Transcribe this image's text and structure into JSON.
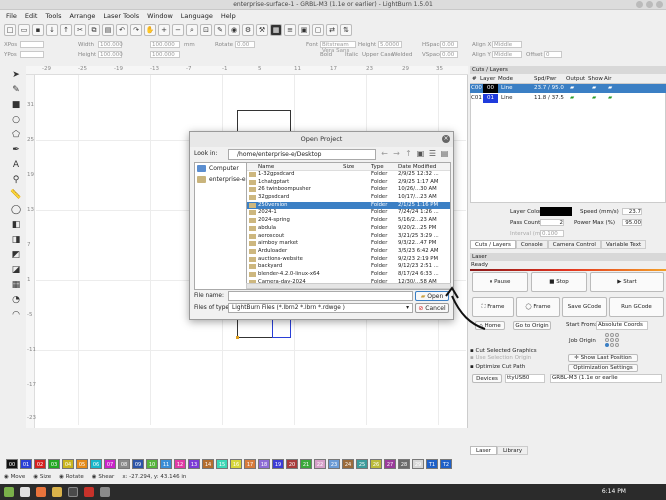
{
  "window": {
    "title": "enterprise-surface-1 - GRBL-M3 (1.1e or earlier) - LightBurn 1.5.01"
  },
  "menu": [
    "File",
    "Edit",
    "Tools",
    "Arrange",
    "Laser Tools",
    "Window",
    "Language",
    "Help"
  ],
  "ruler": {
    "x_ticks": [
      "-29",
      "-25",
      "-19",
      "-13",
      "-7",
      "-1",
      "5",
      "11",
      "17",
      "23",
      "29",
      "35",
      "41"
    ],
    "y_ticks": [
      "31",
      "25",
      "19",
      "13",
      "7",
      "1",
      "-5",
      "-11",
      "-17",
      "-23",
      "-29"
    ]
  },
  "position": {
    "xpos_label": "XPos",
    "ypos_label": "YPos",
    "width_label": "Width",
    "height_label": "Height",
    "xpos": "",
    "ypos": "",
    "width": "100.000",
    "height": "100.000",
    "units": "mm",
    "rotate_label": "Rotate",
    "rotate_value": "0.00"
  },
  "font_row": {
    "font_label": "Font",
    "font_value": "Bitstream Vera Sans",
    "height_label": "Height",
    "height_value": "5.0000",
    "bold": "Bold",
    "italic": "Italic",
    "upper": "Upper Case",
    "welded": "Welded",
    "hspace_label": "HSpace",
    "hspace": "0.00",
    "vspace_label": "VSpace",
    "vspace": "0.00",
    "alignx_label": "Align X",
    "alignx": "Middle",
    "aligny_label": "Align Y",
    "aligny": "Middle",
    "offset_label": "Offset",
    "offset": "0"
  },
  "cuts_layers": {
    "title": "Cuts / Layers",
    "headers": [
      "#",
      "Layer",
      "Mode",
      "Spd/Pwr",
      "Output",
      "Show",
      "Air"
    ],
    "rows": [
      {
        "num": "C00",
        "layer": "00",
        "mode": "Line",
        "spd_pwr": "23.7 / 95.0",
        "color": "#000000",
        "selected": true
      },
      {
        "num": "C01",
        "layer": "01",
        "mode": "Line",
        "spd_pwr": "11.8 / 37.5",
        "color": "#1f3bdc",
        "selected": false
      }
    ],
    "layer_color_label": "Layer Color",
    "speed_label": "Speed (mm/s)",
    "speed_value": "23.7",
    "pass_count_label": "Pass Count",
    "pass_count_value": "2",
    "power_max_label": "Power Max (%)",
    "power_max_value": "95.00",
    "interval_label": "Interval (mm)",
    "interval_value": "0.100",
    "tabs": [
      "Cuts / Layers",
      "Console",
      "Camera Control",
      "Variable Text"
    ]
  },
  "laser": {
    "title": "Laser",
    "status": "Ready",
    "pause": "Pause",
    "stop": "Stop",
    "start": "Start",
    "frame1": "Frame",
    "frame2": "Frame",
    "save_gcode": "Save GCode",
    "run_gcode": "Run GCode",
    "home": "Home",
    "go_to_origin": "Go to Origin",
    "start_from_label": "Start From:",
    "start_from_value": "Absolute Coords",
    "job_origin_label": "Job Origin",
    "cut_selected": "Cut Selected Graphics",
    "use_selection_origin": "Use Selection Origin",
    "show_last_position": "Show Last Position",
    "optimize_cut_path": "Optimize Cut Path",
    "optimization_settings": "Optimization Settings",
    "devices": "Devices",
    "port": "ttyUSB0",
    "device": "GRBL-M3 (1.1e or earlie",
    "bottom_tabs": [
      "Laser",
      "Library"
    ]
  },
  "dialog": {
    "title": "Open Project",
    "look_in_label": "Look in:",
    "path": "/home/enterprise-e/Desktop",
    "places": [
      {
        "label": "Computer",
        "icon": "computer-icon"
      },
      {
        "label": "enterprise-e",
        "icon": "folder-icon"
      }
    ],
    "columns": [
      "Name",
      "Size",
      "Type",
      "Date Modified"
    ],
    "files": [
      {
        "name": "1-32gpsdcard",
        "size": "",
        "type": "Folder",
        "date": "2/9/25 12:32 ..."
      },
      {
        "name": "1chatgptart",
        "size": "",
        "type": "Folder",
        "date": "2/9/25 1:17 AM"
      },
      {
        "name": "26 twinboompusher",
        "size": "",
        "type": "Folder",
        "date": "10/26/...30 AM"
      },
      {
        "name": "32gpsdcard",
        "size": "",
        "type": "Folder",
        "date": "10/17/...23 AM"
      },
      {
        "name": "250version",
        "size": "",
        "type": "Folder",
        "date": "2/1/25 1:16 PM",
        "selected": true
      },
      {
        "name": "2024-1",
        "size": "",
        "type": "Folder",
        "date": "7/24/24 1:26 ..."
      },
      {
        "name": "2024-spring",
        "size": "",
        "type": "Folder",
        "date": "5/16/2...23 AM"
      },
      {
        "name": "abdula",
        "size": "",
        "type": "Folder",
        "date": "9/20/2...25 PM"
      },
      {
        "name": "aeroscout",
        "size": "",
        "type": "Folder",
        "date": "3/21/25 3:29 ..."
      },
      {
        "name": "aimboy market",
        "size": "",
        "type": "Folder",
        "date": "9/3/22...47 PM"
      },
      {
        "name": "Arduloader",
        "size": "",
        "type": "Folder",
        "date": "3/5/23 6:42 AM"
      },
      {
        "name": "auctions-website",
        "size": "",
        "type": "Folder",
        "date": "9/2/23 2:19 PM"
      },
      {
        "name": "backyard",
        "size": "",
        "type": "Folder",
        "date": "9/12/23 2:51 ..."
      },
      {
        "name": "blender-4.2.0-linux-x64",
        "size": "",
        "type": "Folder",
        "date": "8/17/24 6:33 ..."
      },
      {
        "name": "Camera-day-2024",
        "size": "",
        "type": "Folder",
        "date": "12/30/...58 AM"
      }
    ],
    "file_name_label": "File name:",
    "file_name_value": "",
    "files_of_type_label": "Files of type:",
    "files_of_type_value": "LightBurn Files (*.lbrn2 *.lbrn *.rdwge )",
    "open": "Open",
    "cancel": "Cancel"
  },
  "palette": [
    {
      "label": "00",
      "color": "#111111"
    },
    {
      "label": "01",
      "color": "#2a3fd6"
    },
    {
      "label": "02",
      "color": "#d42020"
    },
    {
      "label": "03",
      "color": "#22a822"
    },
    {
      "label": "04",
      "color": "#c9b51f"
    },
    {
      "label": "05",
      "color": "#e58a18"
    },
    {
      "label": "06",
      "color": "#18b6c9"
    },
    {
      "label": "07",
      "color": "#c924c9"
    },
    {
      "label": "08",
      "color": "#8a8a8a"
    },
    {
      "label": "09",
      "color": "#2c54a8"
    },
    {
      "label": "10",
      "color": "#55b33b"
    },
    {
      "label": "11",
      "color": "#3a8ed6"
    },
    {
      "label": "12",
      "color": "#e03aa5"
    },
    {
      "label": "13",
      "color": "#7b3ad6"
    },
    {
      "label": "14",
      "color": "#b56e2e"
    },
    {
      "label": "15",
      "color": "#3bd6b5"
    },
    {
      "label": "16",
      "color": "#d6d63b"
    },
    {
      "label": "17",
      "color": "#d67b3b"
    },
    {
      "label": "18",
      "color": "#8d6cd6"
    },
    {
      "label": "19",
      "color": "#3b3bd6"
    },
    {
      "label": "20",
      "color": "#a83b3b"
    },
    {
      "label": "21",
      "color": "#3ba83b"
    },
    {
      "label": "22",
      "color": "#d6a0c8"
    },
    {
      "label": "23",
      "color": "#6b9bd6"
    },
    {
      "label": "24",
      "color": "#9b6b3b"
    },
    {
      "label": "25",
      "color": "#3b9b9b"
    },
    {
      "label": "26",
      "color": "#bbbb3b"
    },
    {
      "label": "27",
      "color": "#9b3b9b"
    },
    {
      "label": "28",
      "color": "#6b6b6b"
    },
    {
      "label": "29",
      "color": "#d6d6d6"
    },
    {
      "label": "T1",
      "color": "#1e60c8"
    },
    {
      "label": "T2",
      "color": "#1e60c8"
    }
  ],
  "statusbar": {
    "move": "Move",
    "size": "Size",
    "rotate": "Rotate",
    "shear": "Shear",
    "coords": "x: -27.294, y: 43.146 in"
  },
  "clock": "6:14 PM"
}
